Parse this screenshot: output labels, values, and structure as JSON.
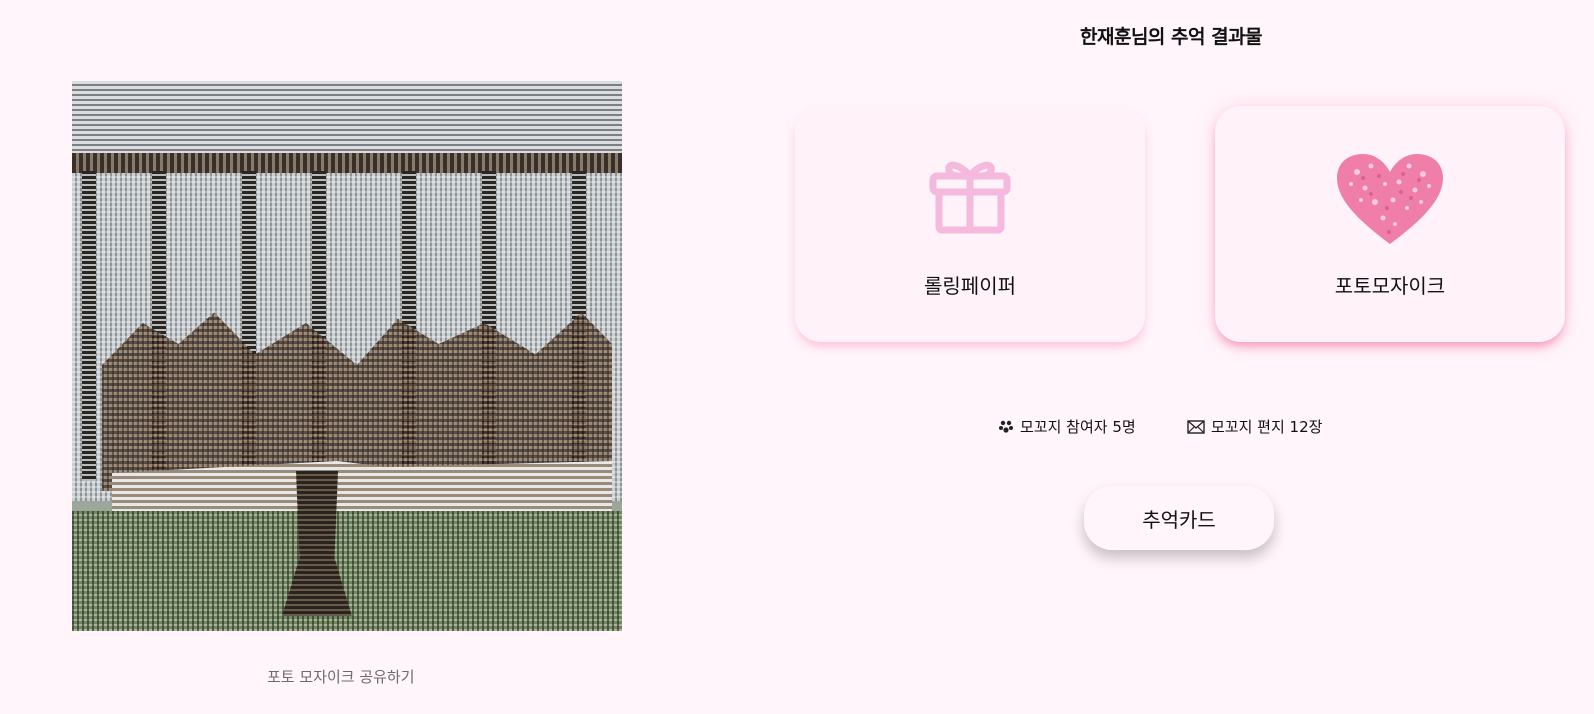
{
  "header": {
    "title": "한재훈님의 추억 결과물"
  },
  "mosaic": {
    "share_label": "포토 모자이크 공유하기"
  },
  "cards": {
    "rolling_paper": {
      "label": "롤링페이퍼",
      "icon": "gift-icon"
    },
    "photo_mosaic": {
      "label": "포토모자이크",
      "icon": "heart-mosaic-icon"
    }
  },
  "stats": {
    "participants": {
      "label": "모꼬지 참여자 5명",
      "icon": "people-icon"
    },
    "letters": {
      "label": "모꼬지 편지 12장",
      "icon": "envelope-icon"
    }
  },
  "actions": {
    "memory_card_label": "추억카드"
  },
  "colors": {
    "background": "#fff5fa",
    "gift_pink": "#f4b9dc",
    "heart_pink": "#ef7fa8"
  }
}
